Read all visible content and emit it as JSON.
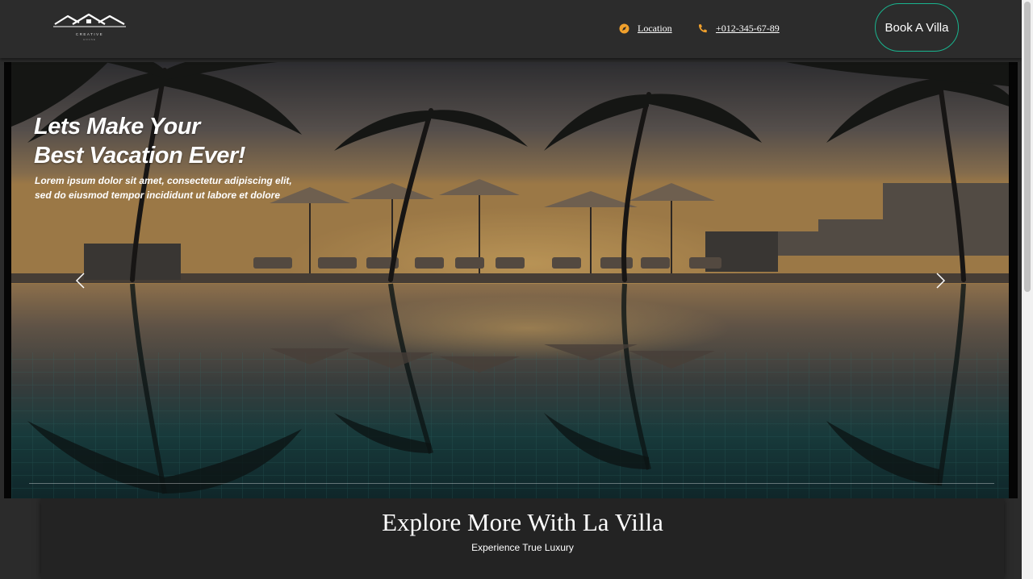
{
  "brand": {
    "logo_text": "CREATIVE",
    "logo_subtext": "HOUSE",
    "icon": "house-roofs-logo"
  },
  "nav": {
    "location_label": "Location",
    "location_icon": "compass-icon",
    "phone_label": "+012-345-67-89",
    "phone_icon": "phone-icon",
    "book_label": "Book A Villa",
    "accent_color": "#f0a02c",
    "button_border_color": "#19b48e"
  },
  "hero": {
    "title_line1": "Lets Make Your",
    "title_line2": "Best Vacation Ever!",
    "subtitle_line1": "Lorem ipsum dolor sit amet, consectetur adipiscing elit,",
    "subtitle_line2": "sed do eiusmod tempor incididunt ut labore et dolore",
    "prev_icon": "chevron-left-icon",
    "next_icon": "chevron-right-icon"
  },
  "explore": {
    "title": "Explore More With La Villa",
    "subtitle": "Experience True Luxury"
  }
}
